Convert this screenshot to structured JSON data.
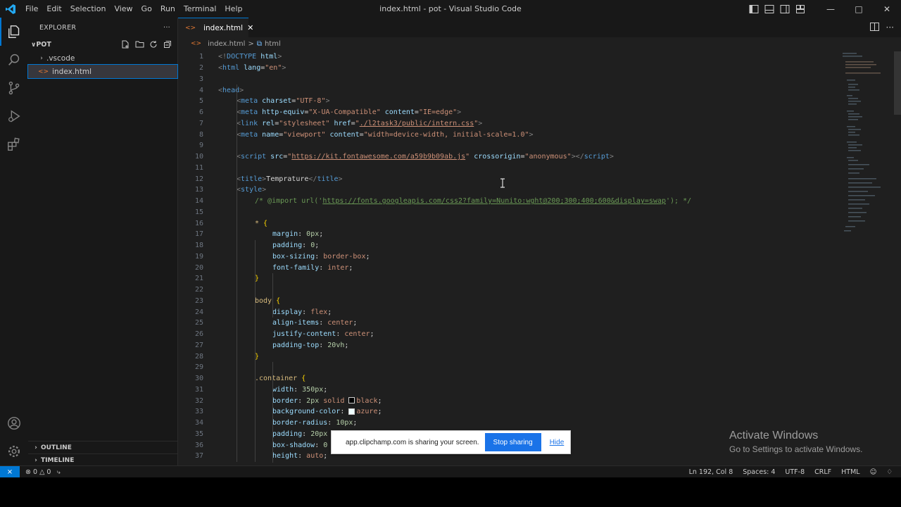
{
  "window": {
    "title": "index.html - pot - Visual Studio Code",
    "menu": [
      "File",
      "Edit",
      "Selection",
      "View",
      "Go",
      "Run",
      "Terminal",
      "Help"
    ]
  },
  "sidebar": {
    "header": "EXPLORER",
    "more": "···",
    "root": "POT",
    "items": [
      {
        "label": ".vscode",
        "type": "folder"
      },
      {
        "label": "index.html",
        "type": "file"
      }
    ],
    "outline": "OUTLINE",
    "timeline": "TIMELINE"
  },
  "editor": {
    "tab": "index.html",
    "breadcrumb_file": "index.html",
    "breadcrumb_sep": ">",
    "breadcrumb_node": "html"
  },
  "code_lines": [
    {
      "n": "1"
    },
    {
      "n": "2"
    },
    {
      "n": "3"
    },
    {
      "n": "4"
    },
    {
      "n": "5"
    },
    {
      "n": "6"
    },
    {
      "n": "7"
    },
    {
      "n": "8"
    },
    {
      "n": "9"
    },
    {
      "n": "10"
    },
    {
      "n": "11"
    },
    {
      "n": "12"
    },
    {
      "n": "13"
    },
    {
      "n": "14"
    },
    {
      "n": "15"
    },
    {
      "n": "16"
    },
    {
      "n": "17"
    },
    {
      "n": "18"
    },
    {
      "n": "19"
    },
    {
      "n": "20"
    },
    {
      "n": "21"
    },
    {
      "n": "22"
    },
    {
      "n": "23"
    },
    {
      "n": "24"
    },
    {
      "n": "25"
    },
    {
      "n": "26"
    },
    {
      "n": "27"
    },
    {
      "n": "28"
    },
    {
      "n": "29"
    },
    {
      "n": "30"
    },
    {
      "n": "31"
    },
    {
      "n": "32"
    },
    {
      "n": "33"
    },
    {
      "n": "34"
    },
    {
      "n": "35"
    },
    {
      "n": "36"
    },
    {
      "n": "37"
    }
  ],
  "code": {
    "l1a": "<!",
    "l1b": "DOCTYPE",
    "l1c": " html",
    "l1d": ">",
    "l2a": "<",
    "l2b": "html",
    "l2c": " lang",
    "l2d": "=",
    "l2e": "\"en\"",
    "l2f": ">",
    "l4a": "<",
    "l4b": "head",
    "l4c": ">",
    "l5a": "<",
    "l5b": "meta",
    "l5c": " charset",
    "l5d": "=",
    "l5e": "\"UTF-8\"",
    "l5f": ">",
    "l6a": "<",
    "l6b": "meta",
    "l6c": " http-equiv",
    "l6d": "=",
    "l6e": "\"X-UA-Compatible\"",
    "l6f": " content",
    "l6g": "=",
    "l6h": "\"IE=edge\"",
    "l6i": ">",
    "l7a": "<",
    "l7b": "link",
    "l7c": " rel",
    "l7d": "=",
    "l7e": "\"stylesheet\"",
    "l7f": " href",
    "l7g": "=",
    "l7h": "\"",
    "l7i": "./l2task3/public/intern.css",
    "l7j": "\"",
    "l7k": ">",
    "l8a": "<",
    "l8b": "meta",
    "l8c": " name",
    "l8d": "=",
    "l8e": "\"viewport\"",
    "l8f": " content",
    "l8g": "=",
    "l8h": "\"width=device-width, initial-scale=1.0\"",
    "l8i": ">",
    "l10a": "<",
    "l10b": "script",
    "l10c": " src",
    "l10d": "=",
    "l10e": "\"",
    "l10f": "https://kit.fontawesome.com/a59b9b09ab.js",
    "l10g": "\"",
    "l10h": " crossorigin",
    "l10i": "=",
    "l10j": "\"anonymous\"",
    "l10k": "></",
    "l10l": "script",
    "l10m": ">",
    "l12a": "<",
    "l12b": "title",
    "l12c": ">",
    "l12d": "Temprature",
    "l12e": "</",
    "l12f": "title",
    "l12g": ">",
    "l13a": "<",
    "l13b": "style",
    "l13c": ">",
    "l14a": "/* @import url('",
    "l14b": "https://fonts.googleapis.com/css2?family=Nunito:wght@200;300;400;600&display=swap",
    "l14c": "'); */",
    "l16a": "*",
    "l16b": " {",
    "l17a": "margin",
    "l17b": ": ",
    "l17c": "0px",
    "l17d": ";",
    "l18a": "padding",
    "l18b": ": ",
    "l18c": "0",
    "l18d": ";",
    "l19a": "box-sizing",
    "l19b": ": ",
    "l19c": "border-box",
    "l19d": ";",
    "l20a": "font-family",
    "l20b": ": ",
    "l20c": "inter",
    "l20d": ";",
    "l21a": "}",
    "l23a": "body",
    "l23b": " {",
    "l24a": "display",
    "l24b": ": ",
    "l24c": "flex",
    "l24d": ";",
    "l25a": "align-items",
    "l25b": ": ",
    "l25c": "center",
    "l25d": ";",
    "l26a": "justify-content",
    "l26b": ": ",
    "l26c": "center",
    "l26d": ";",
    "l27a": "padding-top",
    "l27b": ": ",
    "l27c": "20vh",
    "l27d": ";",
    "l28a": "}",
    "l30a": ".container",
    "l30b": " {",
    "l31a": "width",
    "l31b": ": ",
    "l31c": "350px",
    "l31d": ";",
    "l32a": "border",
    "l32b": ": ",
    "l32c": "2px",
    "l32d": " solid ",
    "l32e": "black",
    "l32f": ";",
    "l33a": "background-color",
    "l33b": ": ",
    "l33c": "azure",
    "l33d": ";",
    "l34a": "border-radius",
    "l34b": ": ",
    "l34c": "10px",
    "l34d": ";",
    "l35a": "padding",
    "l35b": ": ",
    "l35c": "20px",
    "l36a": "box-shadow",
    "l36b": ": ",
    "l36c": "0",
    "l37a": "height",
    "l37b": ": ",
    "l37c": "auto",
    "l37d": ";"
  },
  "share_bar": {
    "message": "app.clipchamp.com is sharing your screen.",
    "stop": "Stop sharing",
    "hide": "Hide"
  },
  "watermark": {
    "line1": "Activate Windows",
    "line2": "Go to Settings to activate Windows."
  },
  "status": {
    "errors": "0",
    "warnings": "0",
    "position": "Ln 192, Col 8",
    "spaces": "Spaces: 4",
    "encoding": "UTF-8",
    "eol": "CRLF",
    "language": "HTML"
  },
  "colors": {
    "accent": "#0078d4",
    "tag": "#569cd6",
    "attribute": "#9cdcfe",
    "string": "#ce9178",
    "comment": "#6a9955",
    "share_button": "#1a73e8"
  }
}
